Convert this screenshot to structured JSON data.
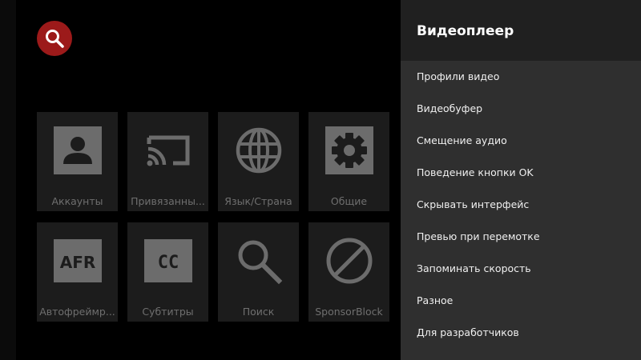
{
  "header": {
    "search_icon": "search-icon",
    "search_color": "#9c1a1a"
  },
  "tiles": [
    {
      "label": "Аккаунты",
      "icon": "account-icon"
    },
    {
      "label": "Привязанны...",
      "icon": "cast-icon"
    },
    {
      "label": "Язык/Страна",
      "icon": "globe-icon"
    },
    {
      "label": "Общие",
      "icon": "gear-icon"
    },
    {
      "label": "Автофреймр...",
      "icon": "afr-icon",
      "icon_text": "AFR"
    },
    {
      "label": "Субтитры",
      "icon": "closed-captions-icon",
      "icon_text": "CC"
    },
    {
      "label": "Поиск",
      "icon": "search-icon"
    },
    {
      "label": "SponsorBlock",
      "icon": "block-icon"
    }
  ],
  "panel": {
    "title": "Видеоплеер",
    "items": [
      {
        "label": "Профили видео"
      },
      {
        "label": "Видеобуфер"
      },
      {
        "label": "Смещение аудио"
      },
      {
        "label": "Поведение кнопки OK"
      },
      {
        "label": "Скрывать интерфейс"
      },
      {
        "label": "Превью при перемотке"
      },
      {
        "label": "Запоминать скорость"
      },
      {
        "label": "Разное"
      },
      {
        "label": "Для разработчиков"
      }
    ]
  },
  "colors": {
    "background": "#000000",
    "tile": "#1c1c1c",
    "tile_icon": "#6c6c6c",
    "panel": "#2f2f2f",
    "panel_header": "#202020"
  }
}
